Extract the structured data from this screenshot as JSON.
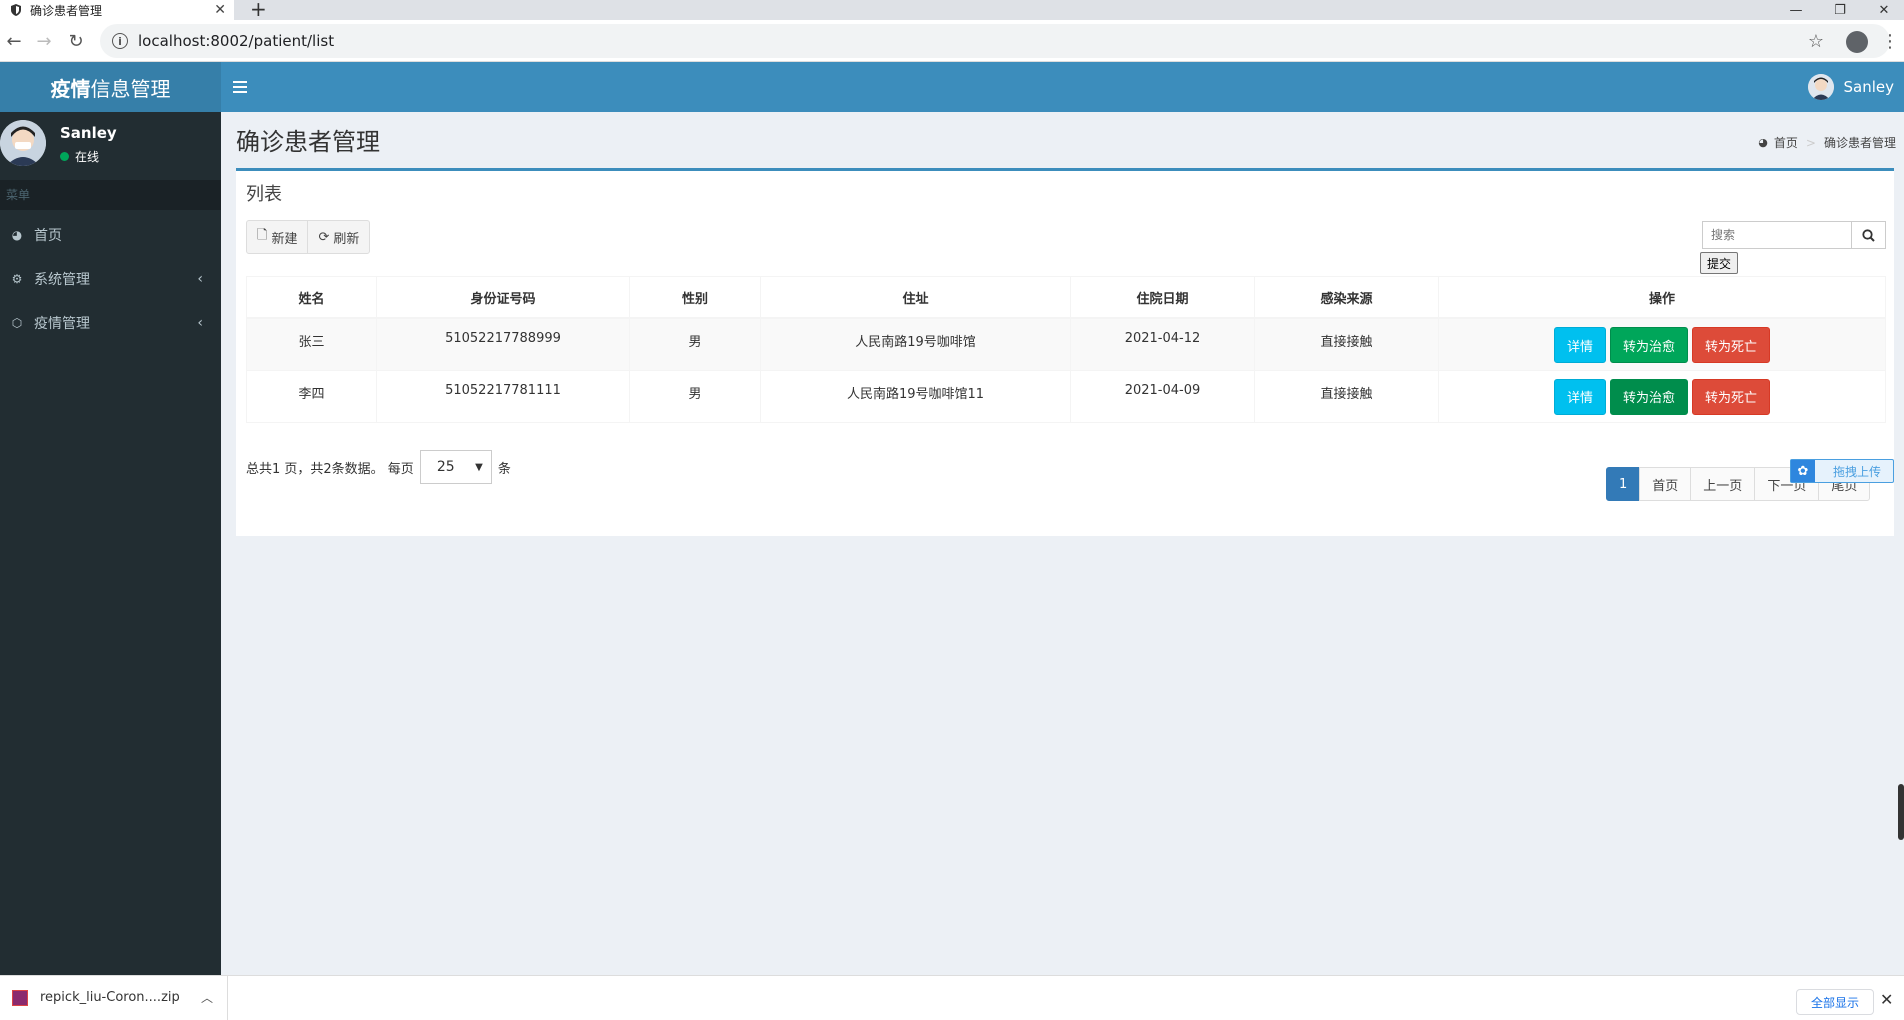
{
  "browser": {
    "tab_title": "确诊患者管理",
    "url": "localhost:8002/patient/list"
  },
  "header": {
    "logo_bold": "疫情",
    "logo_rest": "信息管理",
    "user_name": "Sanley"
  },
  "sidebar": {
    "user_name": "Sanley",
    "user_status": "在线",
    "menu_header": "菜单",
    "items": [
      {
        "label": "首页",
        "icon": "dashboard-icon"
      },
      {
        "label": "系统管理",
        "icon": "cogs-icon"
      },
      {
        "label": "疫情管理",
        "icon": "cube-icon"
      }
    ]
  },
  "content": {
    "page_title": "确诊患者管理",
    "breadcrumb": {
      "home": "首页",
      "current": "确诊患者管理"
    },
    "box_title": "列表",
    "toolbar": {
      "new_label": "新建",
      "refresh_label": "刷新"
    },
    "search": {
      "placeholder": "搜索",
      "submit_label": "提交"
    },
    "table": {
      "columns": [
        "姓名",
        "身份证号码",
        "性别",
        "住址",
        "住院日期",
        "感染来源",
        "操作"
      ],
      "rows": [
        {
          "name": "张三",
          "id_no": "51052217788999",
          "gender": "男",
          "address": "人民南路19号咖啡馆",
          "date": "2021-04-12",
          "source": "直接接触"
        },
        {
          "name": "李四",
          "id_no": "51052217781111",
          "gender": "男",
          "address": "人民南路19号咖啡馆11",
          "date": "2021-04-09",
          "source": "直接接触"
        }
      ],
      "actions": {
        "detail": "详情",
        "cure": "转为治愈",
        "death": "转为死亡"
      }
    },
    "pagination": {
      "summary": "总共1 页，共2条数据。 每页",
      "page_size": "25",
      "unit": "条",
      "current_page": "1",
      "first": "首页",
      "prev": "上一页",
      "next": "下一页",
      "last": "尾页"
    },
    "upload_widget": "拖拽上传"
  },
  "download_bar": {
    "file_name": "repick_liu-Coron....zip",
    "show_all": "全部显示"
  },
  "colors": {
    "header": "#3c8dbc",
    "logo_bg": "#367fa9",
    "sidebar": "#222d32",
    "info": "#00c0ef",
    "success": "#00a65a",
    "danger": "#dd4b39"
  }
}
